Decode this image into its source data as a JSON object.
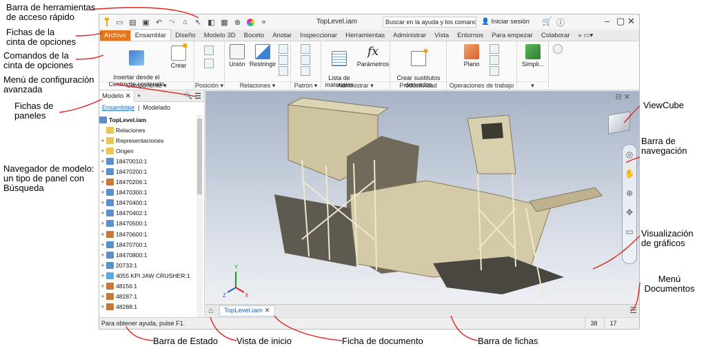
{
  "callouts": {
    "qat": "Barra de herramientas\nde acceso rápido",
    "ribbon_tabs": "Fichas de la\ncinta de opciones",
    "ribbon_cmds": "Comandos de la\ncinta de opciones",
    "adv_menu": "Menú de configuración\navanzada",
    "panel_tabs": "Fichas de\npaneles",
    "browser": "Navegador de modelo:\nun tipo de panel con\nBúsqueda",
    "viewcube": "ViewCube",
    "navbar": "Barra de\nnavegación",
    "graphics": "Visualización\nde gráficos",
    "docs_menu": "Menú\nDocumentos",
    "status_bar": "Barra de Estado",
    "home_view": "Vista de inicio",
    "doc_tab": "Ficha de documento",
    "tabs_bar": "Barra de fichas"
  },
  "window": {
    "title": "TopLevel.iam",
    "search_placeholder": "Buscar en la ayuda y los comandos",
    "signin": "Iniciar sesión"
  },
  "tabs": [
    "Archivo",
    "Ensamblar",
    "Diseño",
    "Modelo 3D",
    "Boceto",
    "Anotar",
    "Inspeccionar",
    "Herramientas",
    "Administrar",
    "Vista",
    "Entornos",
    "Para empezar",
    "Colaborar"
  ],
  "ribbon": {
    "insert": "Insertar desde el\nCentro de contenido",
    "create": "Crear",
    "union": "Unión",
    "restrict": "Restringir",
    "bom": "Lista de\nmateriales",
    "params": "Parámetros",
    "derived": "Crear sustitutos\nderivados",
    "plane": "Plano",
    "simplify": "Simpli...",
    "panels": [
      "Componente ▾",
      "Posición ▾",
      "Relaciones ▾",
      "Patrón ▾",
      "Administrar ▾",
      "Productividad",
      "Operaciones de trabajo",
      "▾"
    ]
  },
  "browser": {
    "tab": "Modelo",
    "sub_assembly": "Ensamblaje",
    "sub_modeling": "Modelado",
    "root": "TopLevel.iam",
    "items": [
      {
        "label": "Relaciones",
        "type": "folder",
        "exp": ""
      },
      {
        "label": "Representaciones",
        "type": "folder",
        "exp": "+"
      },
      {
        "label": "Origen",
        "type": "folder",
        "exp": "+"
      },
      {
        "label": "18470010:1",
        "type": "asm",
        "exp": "+"
      },
      {
        "label": "18470200:1",
        "type": "asm",
        "exp": "+"
      },
      {
        "label": "18470206:1",
        "type": "weld",
        "exp": "+"
      },
      {
        "label": "18470300:1",
        "type": "asm",
        "exp": "+"
      },
      {
        "label": "18470400:1",
        "type": "asm",
        "exp": "+"
      },
      {
        "label": "18470402:1",
        "type": "asm",
        "exp": "+"
      },
      {
        "label": "18470500:1",
        "type": "asm",
        "exp": "+"
      },
      {
        "label": "18470600:1",
        "type": "weld",
        "exp": "+"
      },
      {
        "label": "18470700:1",
        "type": "asm",
        "exp": "+"
      },
      {
        "label": "18470800:1",
        "type": "asm",
        "exp": "+"
      },
      {
        "label": "20733:1",
        "type": "asm",
        "exp": "+"
      },
      {
        "label": "4055 KPI JAW CRUSHER:1",
        "type": "part",
        "exp": "+"
      },
      {
        "label": "48156:1",
        "type": "weld",
        "exp": "+"
      },
      {
        "label": "48287:1",
        "type": "weld",
        "exp": "+"
      },
      {
        "label": "48288:1",
        "type": "weld",
        "exp": "+"
      }
    ]
  },
  "file_tab": "TopLevel.iam",
  "status": {
    "help": "Para obtener ayuda, pulse F1.",
    "count1": "38",
    "count2": "17"
  },
  "colors": {
    "file_tab": "#e8761f",
    "callout_arrow": "#e0201a",
    "structure": "#cdbf98"
  }
}
